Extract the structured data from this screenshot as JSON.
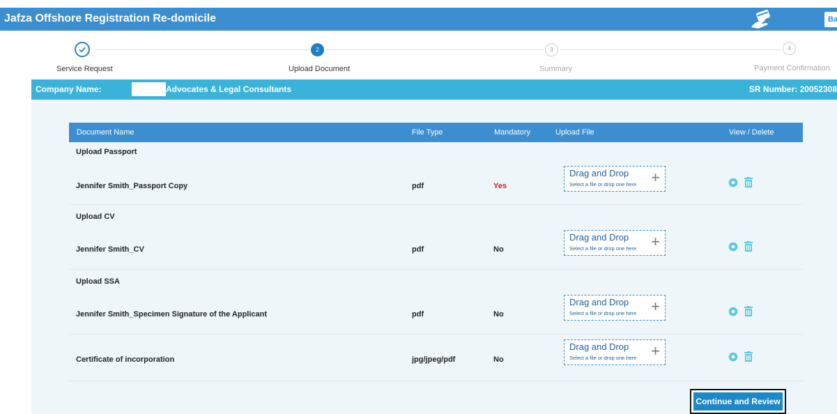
{
  "app": {
    "title": "Jafza Offshore Registration Re-domicile",
    "back_label": "Ba"
  },
  "steps": [
    {
      "label": "Service Request",
      "number": "",
      "state": "completed"
    },
    {
      "label": "Upload Document",
      "number": "2",
      "state": "active"
    },
    {
      "label": "Summary",
      "number": "3",
      "state": "pending"
    },
    {
      "label": "Payment Confirmation",
      "number": "4",
      "state": "pending"
    }
  ],
  "company": {
    "label": "Company Name:",
    "name": "Advocates & Legal Consultants",
    "sr_number": "SR Number: 20052308"
  },
  "table": {
    "headers": [
      "Document Name",
      "File Type",
      "Mandatory",
      "Upload File",
      "View / Delete"
    ],
    "groups": [
      "Upload Passport",
      "Upload CV",
      "Upload SSA"
    ],
    "rows": [
      {
        "name": "Jennifer Smith_Passport Copy",
        "file_type": "pdf",
        "mandatory": "Yes"
      },
      {
        "name": "Jennifer Smith_CV",
        "file_type": "pdf",
        "mandatory": "No"
      },
      {
        "name": "Jennifer Smith_Specimen Signature of the Applicant",
        "file_type": "pdf",
        "mandatory": "No"
      },
      {
        "name": "Certificate of incorporation",
        "file_type": "jpg/jpeg/pdf",
        "mandatory": "No"
      }
    ]
  },
  "dropzone": {
    "title": "Drag and Drop",
    "subtitle": "Select a file or drop one here"
  },
  "icons": {
    "view": "eye-icon",
    "delete": "trash-icon",
    "add": "plus-icon",
    "header": "card-hand-icon",
    "check": "check-icon"
  },
  "colors": {
    "primary": "#3b8fd0",
    "company_bar": "#3ab3db",
    "button": "#1c88c8",
    "mandatory_yes": "#d21f1f",
    "icon": "#5bc8df"
  },
  "actions": {
    "continue_label": "Continue and Review"
  }
}
